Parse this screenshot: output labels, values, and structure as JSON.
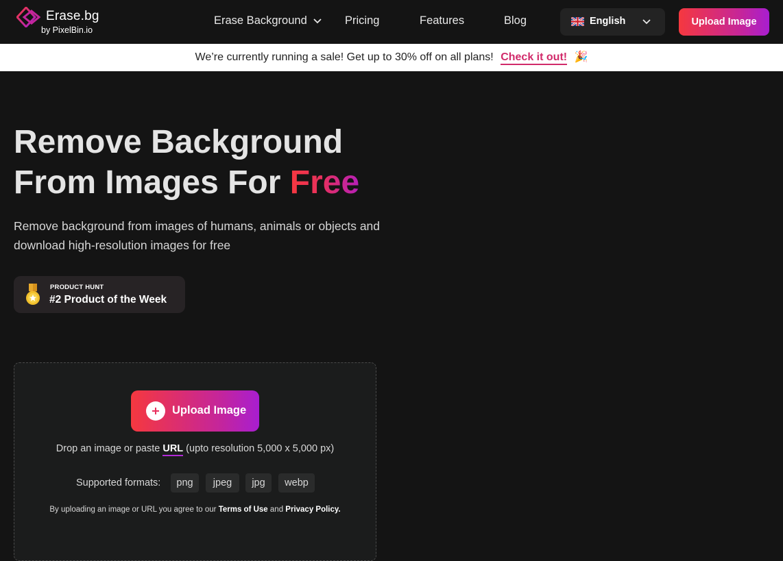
{
  "brand": {
    "title": "Erase.bg",
    "subtitle": "by PixelBin.io"
  },
  "nav": {
    "links": [
      {
        "label": "Erase Background",
        "has_dropdown": true
      },
      {
        "label": "Pricing"
      },
      {
        "label": "Features"
      },
      {
        "label": "Blog"
      }
    ],
    "language": {
      "label": "English",
      "flag": "uk-flag-icon"
    },
    "upload_button": "Upload Image"
  },
  "banner": {
    "text": "We’re currently running a sale! Get up to 30% off on all plans!",
    "link": "Check it out!",
    "emoji": "🎉"
  },
  "hero": {
    "title_line1": "Remove Background",
    "title_line2_prefix": "From Images For ",
    "title_highlight": "Free",
    "subtitle": "Remove background from images of humans, animals or objects and download high-resolution images for free"
  },
  "badge": {
    "kicker": "PRODUCT HUNT",
    "title": "#2 Product of the Week",
    "icon": "medal-icon"
  },
  "upload": {
    "button_label": "Upload Image",
    "drop_prefix": "Drop an image or paste ",
    "drop_link": "URL",
    "drop_suffix": " (upto resolution 5,000 x 5,000 px)",
    "formats_label": "Supported formats:",
    "formats": [
      "png",
      "jpeg",
      "jpg",
      "webp"
    ],
    "terms_prefix": "By uploading an image or URL you agree to our ",
    "terms_link": "Terms of Use",
    "terms_and": " and ",
    "privacy_link": "Privacy Policy."
  },
  "colors": {
    "background": "#141414",
    "accent_start": "#f5383f",
    "accent_end": "#a81ed0",
    "banner_link": "#d12a6a"
  }
}
